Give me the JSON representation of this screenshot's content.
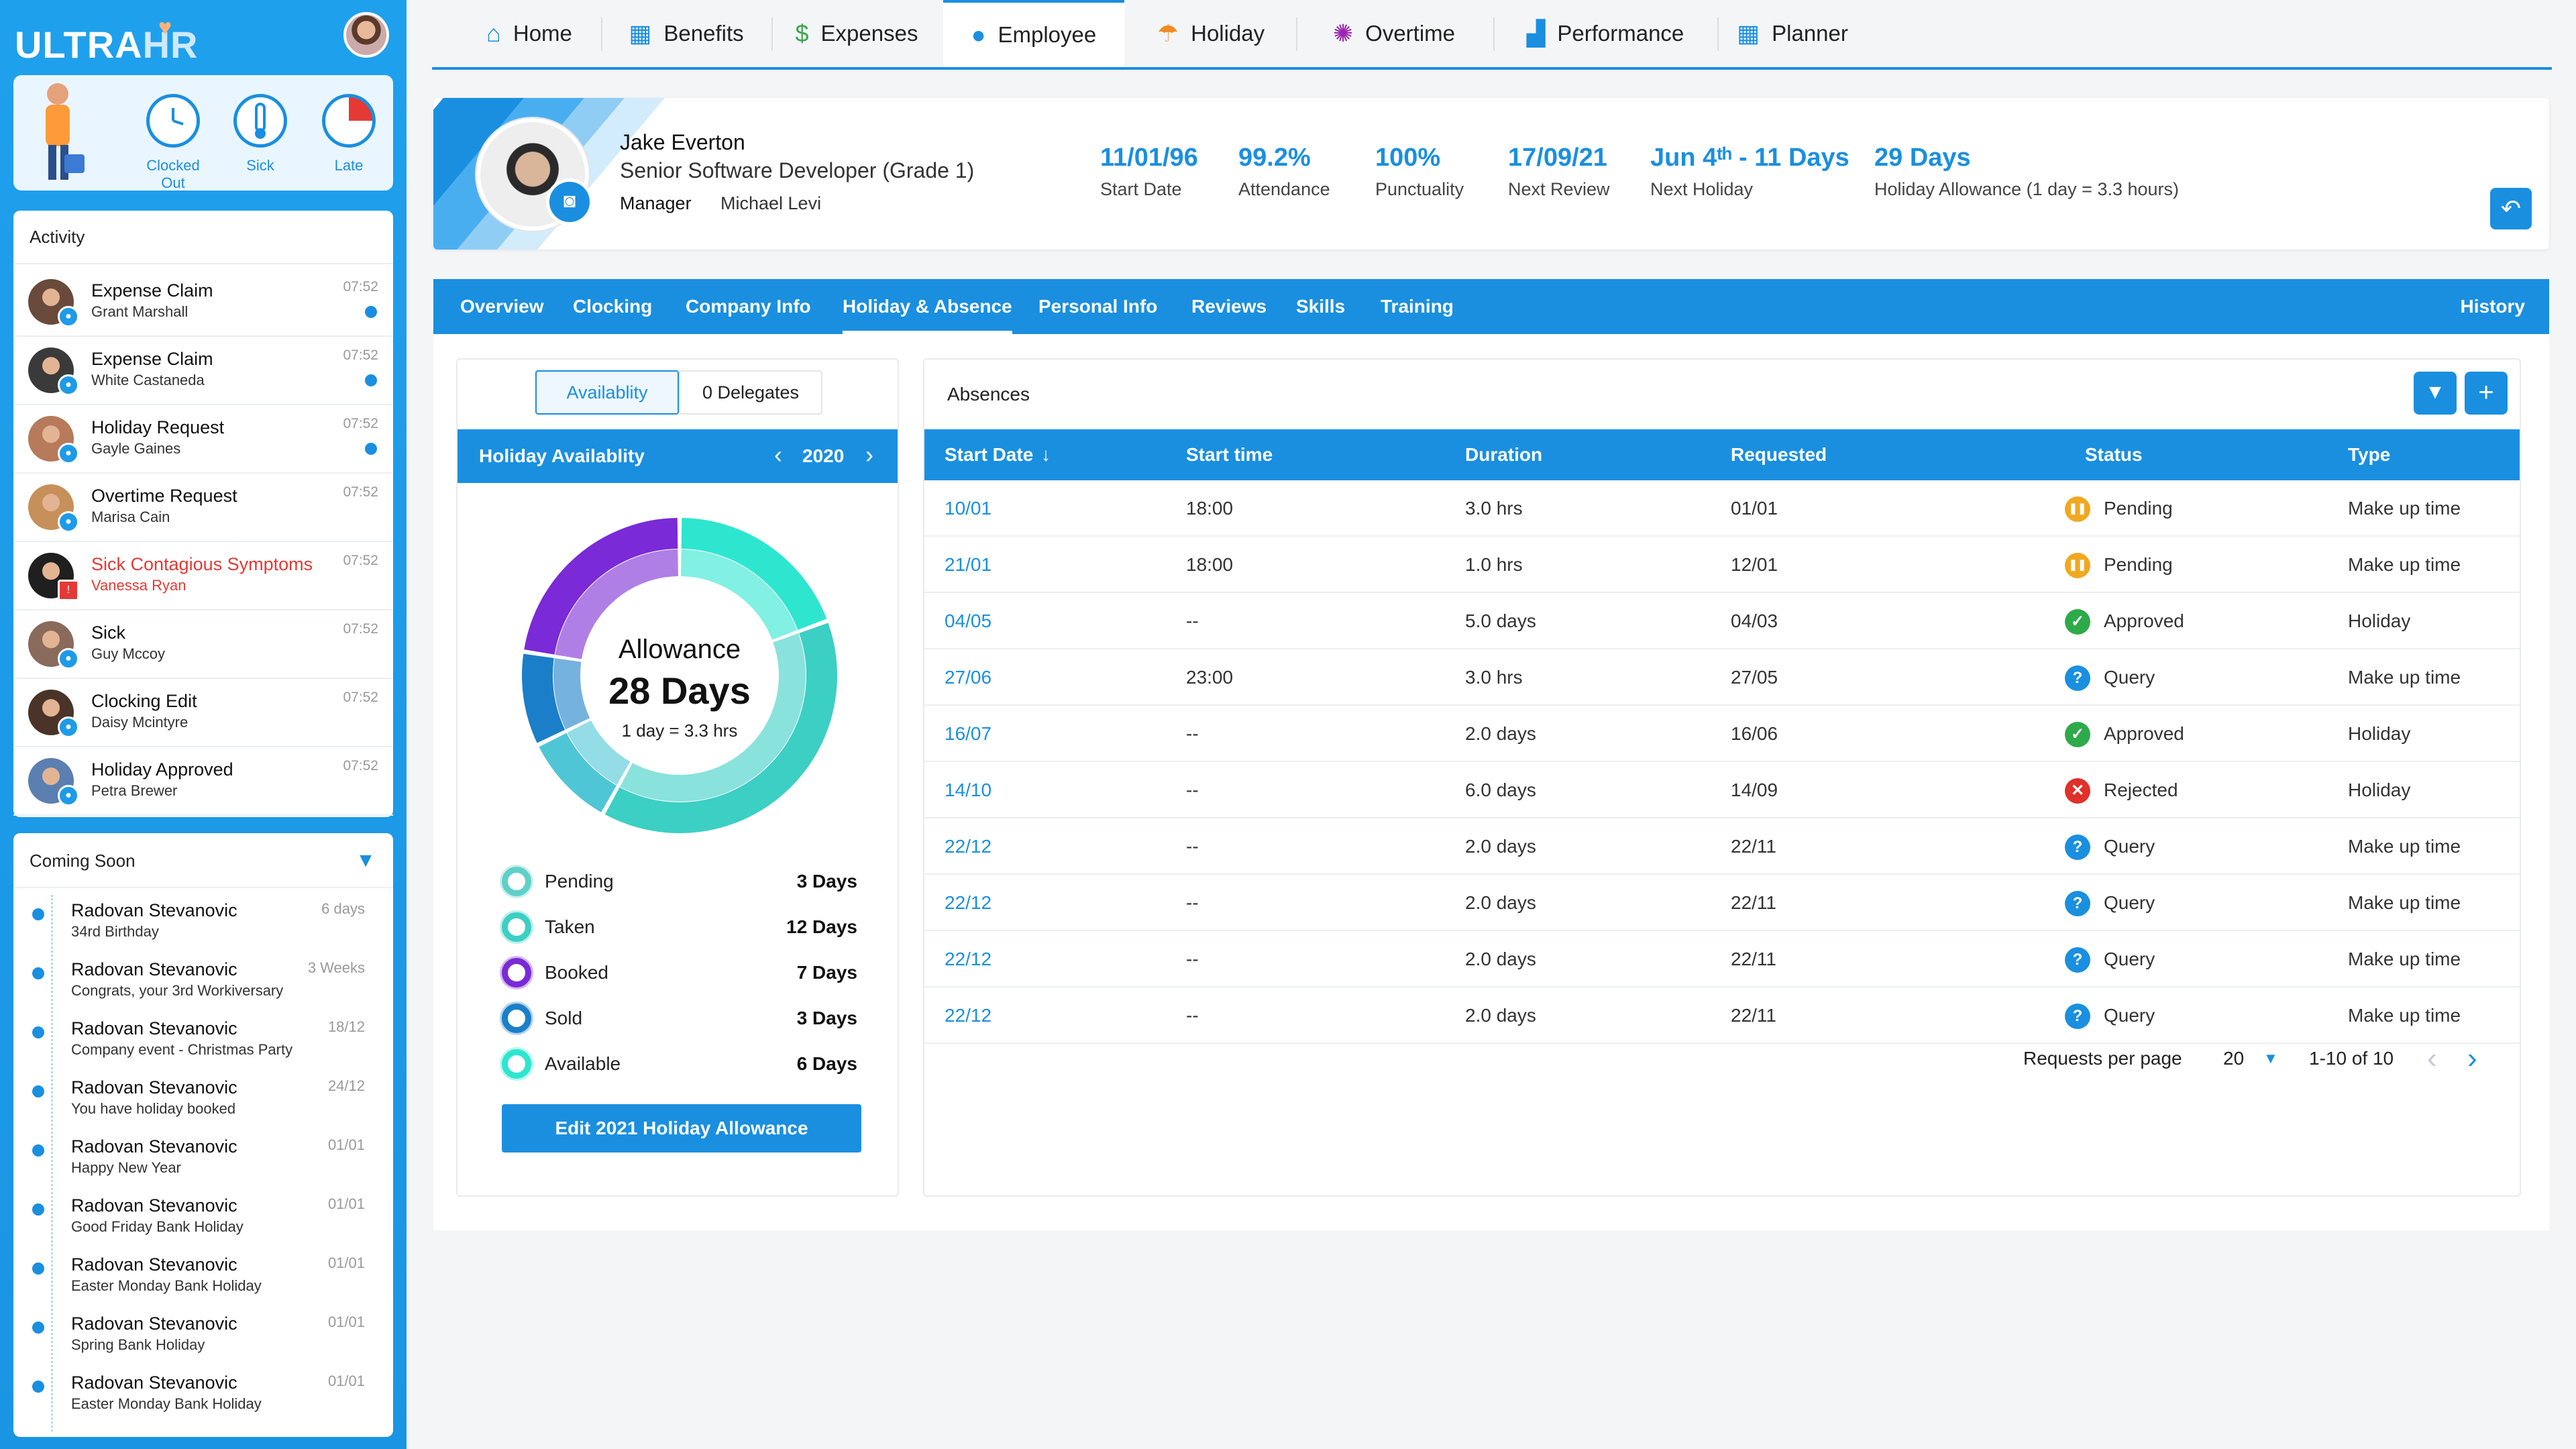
{
  "app": {
    "logo_main": "ULTRA",
    "logo_sub": "HR"
  },
  "status_widgets": [
    {
      "label": "Clocked Out"
    },
    {
      "label": "Sick"
    },
    {
      "label": "Late"
    }
  ],
  "activity": {
    "title": "Activity",
    "items": [
      {
        "title": "Expense Claim",
        "name": "Grant Marshall",
        "time": "07:52",
        "unread": true,
        "alert": false
      },
      {
        "title": "Expense Claim",
        "name": "White Castaneda",
        "time": "07:52",
        "unread": true,
        "alert": false
      },
      {
        "title": "Holiday Request",
        "name": "Gayle Gaines",
        "time": "07:52",
        "unread": true,
        "alert": false
      },
      {
        "title": "Overtime Request",
        "name": "Marisa Cain",
        "time": "07:52",
        "unread": false,
        "alert": false
      },
      {
        "title": "Sick Contagious Symptoms",
        "name": "Vanessa Ryan",
        "time": "07:52",
        "unread": false,
        "alert": true
      },
      {
        "title": "Sick",
        "name": "Guy Mccoy",
        "time": "07:52",
        "unread": false,
        "alert": false
      },
      {
        "title": "Clocking Edit",
        "name": "Daisy Mcintyre",
        "time": "07:52",
        "unread": false,
        "alert": false
      },
      {
        "title": "Holiday Approved",
        "name": "Petra Brewer",
        "time": "07:52",
        "unread": false,
        "alert": false
      }
    ]
  },
  "coming_soon": {
    "title": "Coming Soon",
    "items": [
      {
        "name": "Radovan Stevanovic",
        "desc": "34rd Birthday",
        "time": "6 days"
      },
      {
        "name": "Radovan Stevanovic",
        "desc": "Congrats, your 3rd Workiversary",
        "time": "3 Weeks"
      },
      {
        "name": "Radovan Stevanovic",
        "desc": "Company event - Christmas Party",
        "time": "18/12"
      },
      {
        "name": "Radovan Stevanovic",
        "desc": "You have holiday booked",
        "time": "24/12"
      },
      {
        "name": "Radovan Stevanovic",
        "desc": "Happy New Year",
        "time": "01/01"
      },
      {
        "name": "Radovan Stevanovic",
        "desc": "Good Friday Bank Holiday",
        "time": "01/01"
      },
      {
        "name": "Radovan Stevanovic",
        "desc": "Easter Monday Bank Holiday",
        "time": "01/01"
      },
      {
        "name": "Radovan Stevanovic",
        "desc": "Spring Bank Holiday",
        "time": "01/01"
      },
      {
        "name": "Radovan Stevanovic",
        "desc": "Easter Monday Bank Holiday",
        "time": "01/01"
      }
    ]
  },
  "nav": [
    {
      "label": "Home",
      "icon": "home-icon",
      "glyph": "⌂",
      "color": "#1a8fe0"
    },
    {
      "label": "Benefits",
      "icon": "gift-icon",
      "glyph": "▦",
      "color": "#1a8fe0"
    },
    {
      "label": "Expenses",
      "icon": "money-bag-icon",
      "glyph": "$",
      "color": "#3aa64a"
    },
    {
      "label": "Employee",
      "icon": "user-icon",
      "glyph": "●",
      "color": "#1a8fe0"
    },
    {
      "label": "Holiday",
      "icon": "beach-icon",
      "glyph": "☂",
      "color": "#f08a24"
    },
    {
      "label": "Overtime",
      "icon": "clock-icon",
      "glyph": "✺",
      "color": "#9c27b0"
    },
    {
      "label": "Performance",
      "icon": "chart-icon",
      "glyph": "▟",
      "color": "#1a8fe0"
    },
    {
      "label": "Planner",
      "icon": "calendar-icon",
      "glyph": "▦",
      "color": "#1a8fe0"
    }
  ],
  "profile": {
    "name": "Jake Everton",
    "role": "Senior Software Developer (Grade 1)",
    "manager_label": "Manager",
    "manager": "Michael Levi",
    "stats": [
      {
        "value": "11/01/96",
        "label": "Start Date"
      },
      {
        "value": "99.2%",
        "label": "Attendance"
      },
      {
        "value": "100%",
        "label": "Punctuality"
      },
      {
        "value": "17/09/21",
        "label": "Next Review"
      },
      {
        "value": "Jun 4ᵗʰ - 11 Days",
        "label": "Next Holiday"
      },
      {
        "value": "29 Days",
        "label": "Holiday Allowance (1 day = 3.3 hours)"
      }
    ]
  },
  "subnav": [
    "Overview",
    "Clocking",
    "Company Info",
    "Holiday & Absence",
    "Personal Info",
    "Reviews",
    "Skills",
    "Training"
  ],
  "subnav_right": "History",
  "availability": {
    "tab_active": "Availablity",
    "tab_other": "0 Delegates",
    "bar_title": "Holiday Availablity",
    "year": "2020",
    "center_title": "Allowance",
    "center_value": "28 Days",
    "center_sub": "1 day = 3.3 hrs",
    "legend": [
      {
        "label": "Pending",
        "value": "3 Days",
        "days": 3,
        "color": "#5fd0c8"
      },
      {
        "label": "Taken",
        "value": "12 Days",
        "days": 12,
        "color": "#3ccfc4"
      },
      {
        "label": "Booked",
        "value": "7 Days",
        "days": 7,
        "color": "#7a2ad6"
      },
      {
        "label": "Sold",
        "value": "3 Days",
        "days": 3,
        "color": "#1a7fc8"
      },
      {
        "label": "Available",
        "value": "6 Days",
        "days": 6,
        "color": "#2ee6cf"
      }
    ],
    "edit_button": "Edit 2021 Holiday Allowance"
  },
  "absences": {
    "title": "Absences",
    "columns": [
      "Start Date",
      "Start time",
      "Duration",
      "Requested",
      "Status",
      "Type"
    ],
    "rows": [
      {
        "start": "10/01",
        "time": "18:00",
        "duration": "3.0 hrs",
        "requested": "01/01",
        "status": "Pending",
        "type": "Make up time"
      },
      {
        "start": "21/01",
        "time": "18:00",
        "duration": "1.0 hrs",
        "requested": "12/01",
        "status": "Pending",
        "type": "Make up time"
      },
      {
        "start": "04/05",
        "time": "--",
        "duration": "5.0 days",
        "requested": "04/03",
        "status": "Approved",
        "type": "Holiday"
      },
      {
        "start": "27/06",
        "time": "23:00",
        "duration": "3.0 hrs",
        "requested": "27/05",
        "status": "Query",
        "type": "Make up time"
      },
      {
        "start": "16/07",
        "time": "--",
        "duration": "2.0 days",
        "requested": "16/06",
        "status": "Approved",
        "type": "Holiday"
      },
      {
        "start": "14/10",
        "time": "--",
        "duration": "6.0 days",
        "requested": "14/09",
        "status": "Rejected",
        "type": "Holiday"
      },
      {
        "start": "22/12",
        "time": "--",
        "duration": "2.0 days",
        "requested": "22/11",
        "status": "Query",
        "type": "Make up time"
      },
      {
        "start": "22/12",
        "time": "--",
        "duration": "2.0 days",
        "requested": "22/11",
        "status": "Query",
        "type": "Make up time"
      },
      {
        "start": "22/12",
        "time": "--",
        "duration": "2.0 days",
        "requested": "22/11",
        "status": "Query",
        "type": "Make up time"
      },
      {
        "start": "22/12",
        "time": "--",
        "duration": "2.0 days",
        "requested": "22/11",
        "status": "Query",
        "type": "Make up time"
      }
    ],
    "per_page_label": "Requests per page",
    "per_page": "20",
    "range": "1-10 of 10"
  },
  "status_colors": {
    "Pending": "#f0a820",
    "Approved": "#2eaa4a",
    "Query": "#1a8fe0",
    "Rejected": "#e0302a"
  }
}
